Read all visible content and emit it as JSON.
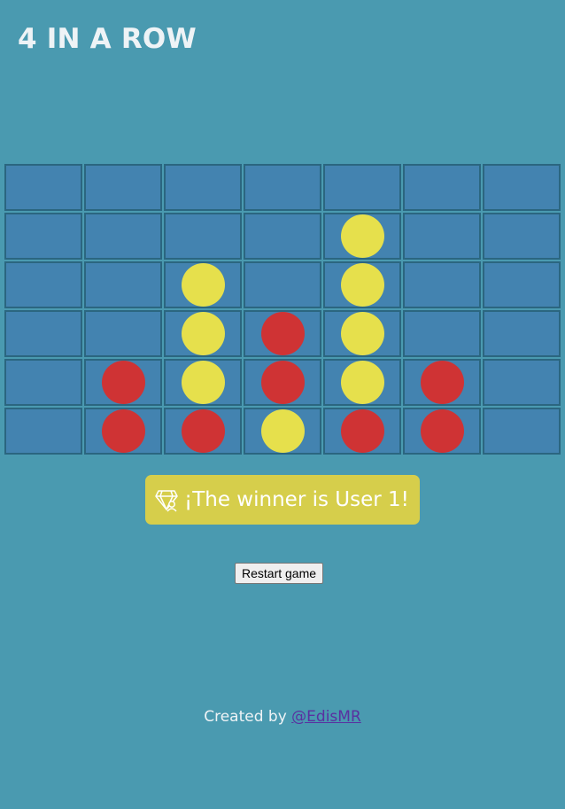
{
  "title": "4 IN A ROW",
  "board": {
    "rows": 6,
    "cols": 7,
    "cells": [
      [
        "",
        "",
        "",
        "",
        "",
        "",
        ""
      ],
      [
        "",
        "",
        "",
        "",
        "yellow",
        "",
        ""
      ],
      [
        "",
        "",
        "yellow",
        "",
        "yellow",
        "",
        ""
      ],
      [
        "",
        "",
        "yellow",
        "red",
        "yellow",
        "",
        ""
      ],
      [
        "",
        "red",
        "yellow",
        "red",
        "yellow",
        "red",
        ""
      ],
      [
        "",
        "red",
        "red",
        "yellow",
        "red",
        "red",
        ""
      ]
    ],
    "colors": {
      "red": "#cf3334",
      "yellow": "#e6e04c",
      "cell": "#4383b0",
      "cell_border": "#2b6680"
    }
  },
  "winner": {
    "icon": "trophy-icon",
    "text": "¡The winner is User 1!"
  },
  "restart_label": "Restart game",
  "footer": {
    "prefix": "Created by ",
    "link_text": "@EdisMR"
  },
  "colors": {
    "background": "#4a9ab0",
    "winner_banner": "#d6ce4b"
  }
}
